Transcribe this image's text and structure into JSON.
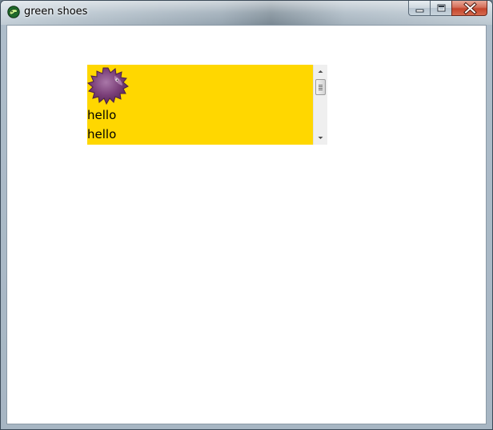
{
  "window": {
    "title": "green shoes",
    "app_icon": "green-shoes-icon",
    "buttons": {
      "minimize_icon": "minimize-icon",
      "maximize_icon": "maximize-icon",
      "close_icon": "close-icon"
    }
  },
  "slot": {
    "background": "#ffd700",
    "image_icon": "shoes-mascot-image",
    "lines": [
      "hello",
      "hello"
    ],
    "scrollbar": {
      "up_icon": "scroll-up-arrow-icon",
      "down_icon": "scroll-down-arrow-icon"
    }
  },
  "colors": {
    "client_background": "#ffffff",
    "slot_background": "#ffd700",
    "close_button": "#c4442b"
  }
}
